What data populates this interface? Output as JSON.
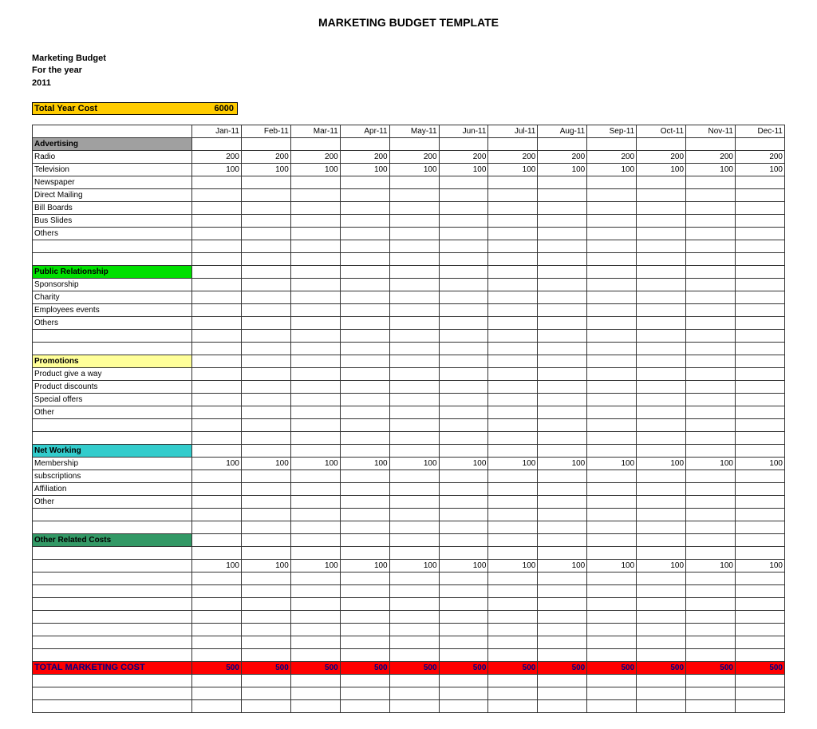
{
  "title": "MARKETING BUDGET TEMPLATE",
  "header": {
    "line1": "Marketing Budget",
    "line2": "For the year",
    "line3": "2011"
  },
  "total_year": {
    "label": "Total Year Cost",
    "value": "6000"
  },
  "months": [
    "Jan-11",
    "Feb-11",
    "Mar-11",
    "Apr-11",
    "May-11",
    "Jun-11",
    "Jul-11",
    "Aug-11",
    "Sep-11",
    "Oct-11",
    "Nov-11",
    "Dec-11"
  ],
  "sections": [
    {
      "key": "advertising",
      "label": "Advertising",
      "rows": [
        {
          "label": "Radio",
          "values": [
            "200",
            "200",
            "200",
            "200",
            "200",
            "200",
            "200",
            "200",
            "200",
            "200",
            "200",
            "200"
          ]
        },
        {
          "label": "Television",
          "values": [
            "100",
            "100",
            "100",
            "100",
            "100",
            "100",
            "100",
            "100",
            "100",
            "100",
            "100",
            "100"
          ]
        },
        {
          "label": "Newspaper",
          "values": [
            "",
            "",
            "",
            "",
            "",
            "",
            "",
            "",
            "",
            "",
            "",
            ""
          ]
        },
        {
          "label": "Direct Mailing",
          "values": [
            "",
            "",
            "",
            "",
            "",
            "",
            "",
            "",
            "",
            "",
            "",
            ""
          ]
        },
        {
          "label": "Bill Boards",
          "values": [
            "",
            "",
            "",
            "",
            "",
            "",
            "",
            "",
            "",
            "",
            "",
            ""
          ]
        },
        {
          "label": "Bus Slides",
          "values": [
            "",
            "",
            "",
            "",
            "",
            "",
            "",
            "",
            "",
            "",
            "",
            ""
          ]
        },
        {
          "label": "Others",
          "values": [
            "",
            "",
            "",
            "",
            "",
            "",
            "",
            "",
            "",
            "",
            "",
            ""
          ]
        }
      ],
      "trailing_blank": 2
    },
    {
      "key": "public-rel",
      "label": "Public Relationship",
      "rows": [
        {
          "label": "Sponsorship",
          "values": [
            "",
            "",
            "",
            "",
            "",
            "",
            "",
            "",
            "",
            "",
            "",
            ""
          ]
        },
        {
          "label": "Charity",
          "values": [
            "",
            "",
            "",
            "",
            "",
            "",
            "",
            "",
            "",
            "",
            "",
            ""
          ]
        },
        {
          "label": "Employees events",
          "values": [
            "",
            "",
            "",
            "",
            "",
            "",
            "",
            "",
            "",
            "",
            "",
            ""
          ]
        },
        {
          "label": "Others",
          "values": [
            "",
            "",
            "",
            "",
            "",
            "",
            "",
            "",
            "",
            "",
            "",
            ""
          ]
        }
      ],
      "trailing_blank": 2
    },
    {
      "key": "promotions",
      "label": "Promotions",
      "rows": [
        {
          "label": "Product give a way",
          "values": [
            "",
            "",
            "",
            "",
            "",
            "",
            "",
            "",
            "",
            "",
            "",
            ""
          ]
        },
        {
          "label": "Product discounts",
          "values": [
            "",
            "",
            "",
            "",
            "",
            "",
            "",
            "",
            "",
            "",
            "",
            ""
          ]
        },
        {
          "label": "Special offers",
          "values": [
            "",
            "",
            "",
            "",
            "",
            "",
            "",
            "",
            "",
            "",
            "",
            ""
          ]
        },
        {
          "label": "Other",
          "values": [
            "",
            "",
            "",
            "",
            "",
            "",
            "",
            "",
            "",
            "",
            "",
            ""
          ]
        }
      ],
      "trailing_blank": 2
    },
    {
      "key": "networking",
      "label": "Net Working",
      "rows": [
        {
          "label": "Membership",
          "values": [
            "100",
            "100",
            "100",
            "100",
            "100",
            "100",
            "100",
            "100",
            "100",
            "100",
            "100",
            "100"
          ]
        },
        {
          "label": "subscriptions",
          "values": [
            "",
            "",
            "",
            "",
            "",
            "",
            "",
            "",
            "",
            "",
            "",
            ""
          ]
        },
        {
          "label": "Affiliation",
          "values": [
            "",
            "",
            "",
            "",
            "",
            "",
            "",
            "",
            "",
            "",
            "",
            ""
          ]
        },
        {
          "label": "Other",
          "values": [
            "",
            "",
            "",
            "",
            "",
            "",
            "",
            "",
            "",
            "",
            "",
            ""
          ]
        }
      ],
      "trailing_blank": 2
    },
    {
      "key": "other-rel",
      "label": "Other Related Costs",
      "rows": [
        {
          "label": "",
          "values": [
            "",
            "",
            "",
            "",
            "",
            "",
            "",
            "",
            "",
            "",
            "",
            ""
          ]
        },
        {
          "label": "",
          "values": [
            "100",
            "100",
            "100",
            "100",
            "100",
            "100",
            "100",
            "100",
            "100",
            "100",
            "100",
            "100"
          ]
        },
        {
          "label": "",
          "values": [
            "",
            "",
            "",
            "",
            "",
            "",
            "",
            "",
            "",
            "",
            "",
            ""
          ]
        },
        {
          "label": "",
          "values": [
            "",
            "",
            "",
            "",
            "",
            "",
            "",
            "",
            "",
            "",
            "",
            ""
          ]
        },
        {
          "label": "",
          "values": [
            "",
            "",
            "",
            "",
            "",
            "",
            "",
            "",
            "",
            "",
            "",
            ""
          ]
        },
        {
          "label": "",
          "values": [
            "",
            "",
            "",
            "",
            "",
            "",
            "",
            "",
            "",
            "",
            "",
            ""
          ]
        },
        {
          "label": "",
          "values": [
            "",
            "",
            "",
            "",
            "",
            "",
            "",
            "",
            "",
            "",
            "",
            ""
          ]
        },
        {
          "label": "",
          "values": [
            "",
            "",
            "",
            "",
            "",
            "",
            "",
            "",
            "",
            "",
            "",
            ""
          ]
        }
      ],
      "trailing_blank": 1
    }
  ],
  "total_row": {
    "label": "TOTAL MARKETING COST",
    "values": [
      "500",
      "500",
      "500",
      "500",
      "500",
      "500",
      "500",
      "500",
      "500",
      "500",
      "500",
      "500"
    ]
  },
  "footer_blank": 3,
  "chart_data": {
    "type": "table",
    "title": "Marketing Budget 2011 — monthly costs by category",
    "columns": [
      "Jan-11",
      "Feb-11",
      "Mar-11",
      "Apr-11",
      "May-11",
      "Jun-11",
      "Jul-11",
      "Aug-11",
      "Sep-11",
      "Oct-11",
      "Nov-11",
      "Dec-11"
    ],
    "rows": [
      {
        "name": "Radio",
        "values": [
          200,
          200,
          200,
          200,
          200,
          200,
          200,
          200,
          200,
          200,
          200,
          200
        ]
      },
      {
        "name": "Television",
        "values": [
          100,
          100,
          100,
          100,
          100,
          100,
          100,
          100,
          100,
          100,
          100,
          100
        ]
      },
      {
        "name": "Membership",
        "values": [
          100,
          100,
          100,
          100,
          100,
          100,
          100,
          100,
          100,
          100,
          100,
          100
        ]
      },
      {
        "name": "Other Related Costs",
        "values": [
          100,
          100,
          100,
          100,
          100,
          100,
          100,
          100,
          100,
          100,
          100,
          100
        ]
      }
    ],
    "totals": {
      "per_month": [
        500,
        500,
        500,
        500,
        500,
        500,
        500,
        500,
        500,
        500,
        500,
        500
      ],
      "year": 6000
    }
  }
}
